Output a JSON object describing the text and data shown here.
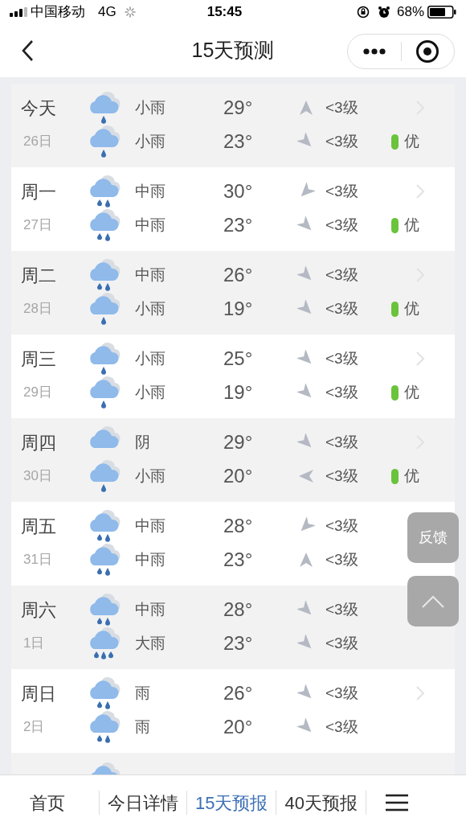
{
  "status_bar": {
    "carrier": "中国移动",
    "network": "4G",
    "time": "15:45",
    "battery": "68%"
  },
  "header": {
    "title": "15天预测"
  },
  "days": [
    {
      "day": "今天",
      "date": "26日",
      "aqi": "优",
      "lines": [
        {
          "kind": "light",
          "weather": "小雨",
          "temp": "29°",
          "wind_arrow": {
            "kind": "north"
          },
          "wind": "<3级"
        },
        {
          "kind": "light",
          "weather": "小雨",
          "temp": "23°",
          "wind_arrow": {
            "kind": "southeast"
          },
          "wind": "<3级"
        }
      ]
    },
    {
      "day": "周一",
      "date": "27日",
      "aqi": "优",
      "lines": [
        {
          "kind": "moderate",
          "weather": "中雨",
          "temp": "30°",
          "wind_arrow": {
            "kind": "southwest"
          },
          "wind": "<3级"
        },
        {
          "kind": "moderate",
          "weather": "中雨",
          "temp": "23°",
          "wind_arrow": {
            "kind": "southeast"
          },
          "wind": "<3级"
        }
      ]
    },
    {
      "day": "周二",
      "date": "28日",
      "aqi": "优",
      "lines": [
        {
          "kind": "moderate",
          "weather": "中雨",
          "temp": "26°",
          "wind_arrow": {
            "kind": "southeast"
          },
          "wind": "<3级"
        },
        {
          "kind": "light",
          "weather": "小雨",
          "temp": "19°",
          "wind_arrow": {
            "kind": "southeast"
          },
          "wind": "<3级"
        }
      ]
    },
    {
      "day": "周三",
      "date": "29日",
      "aqi": "优",
      "lines": [
        {
          "kind": "light",
          "weather": "小雨",
          "temp": "25°",
          "wind_arrow": {
            "kind": "southeast"
          },
          "wind": "<3级"
        },
        {
          "kind": "light",
          "weather": "小雨",
          "temp": "19°",
          "wind_arrow": {
            "kind": "southeast"
          },
          "wind": "<3级"
        }
      ]
    },
    {
      "day": "周四",
      "date": "30日",
      "aqi": "优",
      "lines": [
        {
          "kind": "overcast",
          "weather": "阴",
          "temp": "29°",
          "wind_arrow": {
            "kind": "southeast"
          },
          "wind": "<3级"
        },
        {
          "kind": "light",
          "weather": "小雨",
          "temp": "20°",
          "wind_arrow": {
            "kind": "west"
          },
          "wind": "<3级"
        }
      ]
    },
    {
      "day": "周五",
      "date": "31日",
      "lines": [
        {
          "kind": "moderate",
          "weather": "中雨",
          "temp": "28°",
          "wind_arrow": {
            "kind": "southwest"
          },
          "wind": "<3级"
        },
        {
          "kind": "moderate",
          "weather": "中雨",
          "temp": "23°",
          "wind_arrow": {
            "kind": "north"
          },
          "wind": "<3级"
        }
      ]
    },
    {
      "day": "周六",
      "date": "1日",
      "lines": [
        {
          "kind": "moderate",
          "weather": "中雨",
          "temp": "28°",
          "wind_arrow": {
            "kind": "southeast"
          },
          "wind": "<3级"
        },
        {
          "kind": "heavy",
          "weather": "大雨",
          "temp": "23°",
          "wind_arrow": {
            "kind": "southeast"
          },
          "wind": "<3级"
        }
      ]
    },
    {
      "day": "周日",
      "date": "2日",
      "lines": [
        {
          "kind": "moderate",
          "weather": "雨",
          "temp": "26°",
          "wind_arrow": {
            "kind": "southeast"
          },
          "wind": "<3级"
        },
        {
          "kind": "moderate",
          "weather": "雨",
          "temp": "20°",
          "wind_arrow": {
            "kind": "southeast"
          },
          "wind": "<3级"
        }
      ]
    }
  ],
  "float_buttons": {
    "feedback": "反馈"
  },
  "tab_bar": [
    {
      "label": "首页",
      "selected": false
    },
    {
      "label": "今日详情",
      "selected": false
    },
    {
      "label": "15天预报",
      "selected": true
    },
    {
      "label": "40天预报",
      "selected": false
    }
  ]
}
